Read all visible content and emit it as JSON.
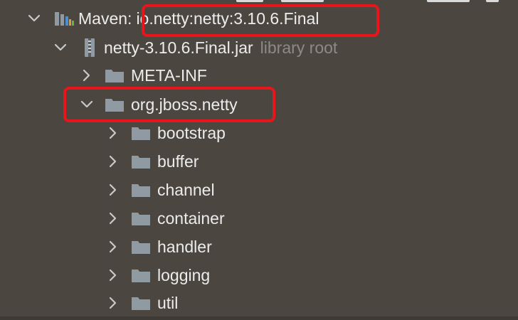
{
  "colors": {
    "background": "#4b4740",
    "text": "#ececec",
    "hint_text": "#8c8a86",
    "folder_icon": "#8f9aa3",
    "highlight": "#e8151b"
  },
  "tree": {
    "maven_node": {
      "prefix": "Maven:",
      "coordinates": "io.netty:netty:3.10.6.Final",
      "icon": "maven-library-icon",
      "expanded": true
    },
    "jar_node": {
      "label": "netty-3.10.6.Final.jar",
      "hint": "library root",
      "icon": "jar-archive-icon",
      "expanded": true
    },
    "meta_inf": {
      "label": "META-INF",
      "icon": "folder-icon",
      "expanded": false
    },
    "package_root": {
      "label": "org.jboss.netty",
      "icon": "folder-icon",
      "expanded": true
    },
    "subpackages": [
      {
        "label": "bootstrap",
        "icon": "folder-icon"
      },
      {
        "label": "buffer",
        "icon": "folder-icon"
      },
      {
        "label": "channel",
        "icon": "folder-icon"
      },
      {
        "label": "container",
        "icon": "folder-icon"
      },
      {
        "label": "handler",
        "icon": "folder-icon"
      },
      {
        "label": "logging",
        "icon": "folder-icon"
      },
      {
        "label": "util",
        "icon": "folder-icon"
      }
    ]
  }
}
